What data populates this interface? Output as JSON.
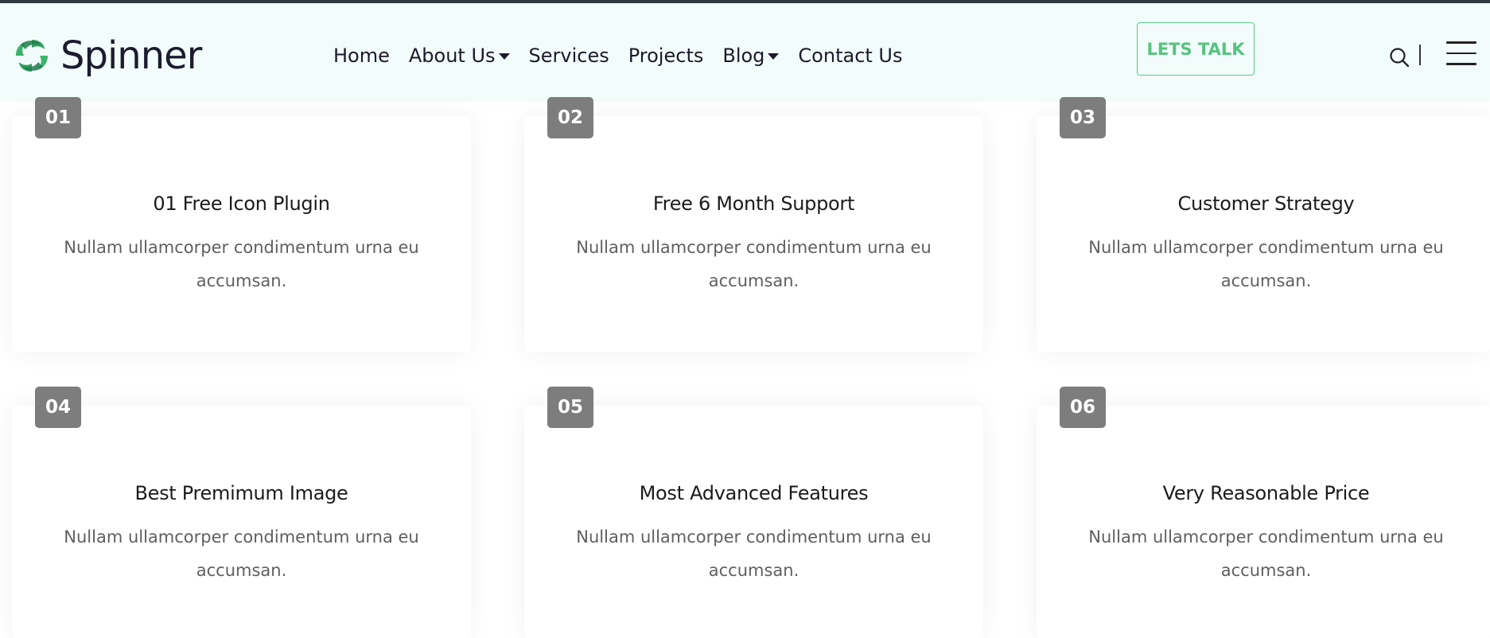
{
  "brand": {
    "name": "Spinner",
    "accent": "#55c47e",
    "logo_dark": "#1e7a4a"
  },
  "nav": {
    "items": [
      {
        "label": "Home",
        "dropdown": false
      },
      {
        "label": "About Us",
        "dropdown": true
      },
      {
        "label": "Services",
        "dropdown": false
      },
      {
        "label": "Projects",
        "dropdown": false
      },
      {
        "label": "Blog",
        "dropdown": true
      },
      {
        "label": "Contact Us",
        "dropdown": false
      }
    ],
    "cta_label": "LETS TALK"
  },
  "icons": {
    "search": "search-icon",
    "menu": "hamburger-menu-icon",
    "logo": "spinner-logo-icon"
  },
  "cards": [
    {
      "number": "01",
      "title": "01 Free Icon Plugin",
      "text": "Nullam ullamcorper condimentum urna eu accumsan."
    },
    {
      "number": "02",
      "title": "Free 6 Month Support",
      "text": "Nullam ullamcorper condimentum urna eu accumsan."
    },
    {
      "number": "03",
      "title": "Customer Strategy",
      "text": "Nullam ullamcorper condimentum urna eu accumsan."
    },
    {
      "number": "04",
      "title": "Best Premimum Image",
      "text": "Nullam ullamcorper condimentum urna eu accumsan."
    },
    {
      "number": "05",
      "title": "Most Advanced Features",
      "text": "Nullam ullamcorper condimentum urna eu accumsan."
    },
    {
      "number": "06",
      "title": "Very Reasonable Price",
      "text": "Nullam ullamcorper condimentum urna eu accumsan."
    }
  ]
}
